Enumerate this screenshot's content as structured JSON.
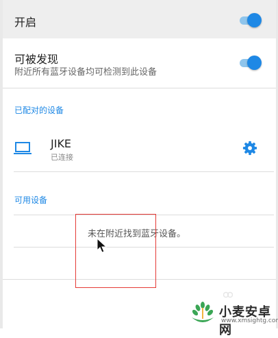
{
  "settings": {
    "enable": {
      "label": "开启",
      "on": true
    },
    "discoverable": {
      "title": "可被发现",
      "subtitle": "附近所有蓝牙设备均可检测到此设备",
      "on": true
    }
  },
  "paired": {
    "header": "已配对的设备",
    "devices": [
      {
        "name": "JIKE",
        "status": "已连接",
        "icon": "laptop-icon",
        "action_icon": "gear-icon"
      }
    ]
  },
  "available": {
    "header": "可用设备",
    "empty_message": "未在附近找到蓝牙设备。"
  },
  "watermark": {
    "brand": "小麦安卓网",
    "url": "www.xmsightg.com"
  },
  "colors": {
    "accent": "#1e88e5",
    "highlight_box": "#e53935",
    "watermark_green": "#3aa655"
  }
}
